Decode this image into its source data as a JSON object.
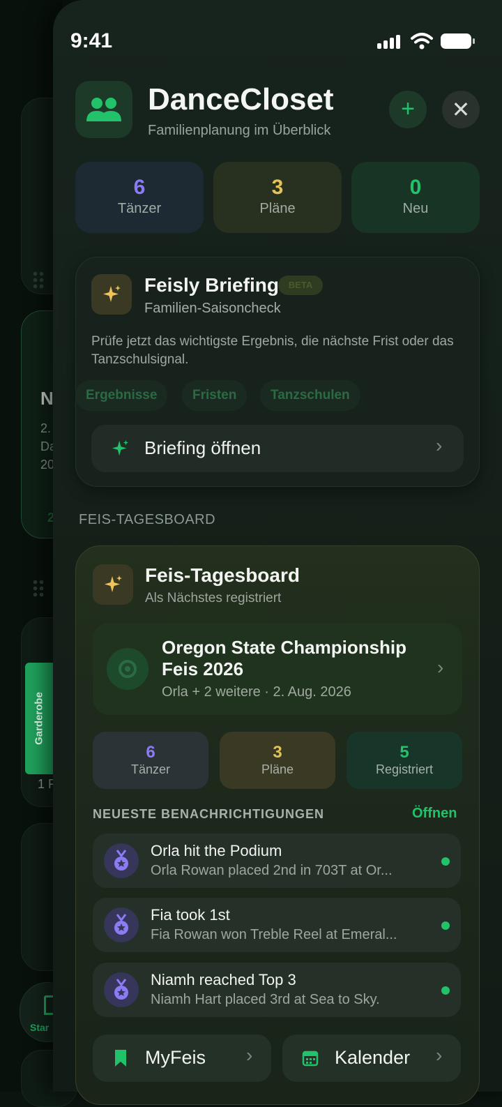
{
  "background_app": {
    "section_letter": "N",
    "lines": [
      "2.",
      "Da",
      "20"
    ],
    "badge": "2",
    "wardrobe_tab": "Garderobe",
    "footer_text": "1 F",
    "home_label": "Star"
  },
  "status_bar": {
    "time": "9:41"
  },
  "header": {
    "app_name": "DanceCloset",
    "subtitle": "Familienplanung im Überblick",
    "add_icon": "+",
    "close_icon": "✕"
  },
  "stats": [
    {
      "value": "6",
      "label": "Tänzer",
      "color": "#8b7cf6"
    },
    {
      "value": "3",
      "label": "Pläne",
      "color": "#e2c35a"
    },
    {
      "value": "0",
      "label": "Neu",
      "color": "#22c26a"
    }
  ],
  "briefing": {
    "title": "Feisly Briefing",
    "badge": "BETA",
    "subtitle": "Familien-Saisoncheck",
    "description": "Prüfe jetzt das wichtigste Ergebnis, die nächste Frist oder das Tanzschulsignal.",
    "chips": [
      "Ergebnisse",
      "Fristen",
      "Tanzschulen"
    ],
    "open_label": "Briefing öffnen"
  },
  "section_label": "FEIS-TAGESBOARD",
  "board": {
    "title": "Feis-Tagesboard",
    "subtitle": "Als Nächstes registriert",
    "event": {
      "title": "Oregon State Championship Feis 2026",
      "meta": "Orla + 2 weitere · 2. Aug. 2026"
    },
    "mini_stats": [
      {
        "value": "6",
        "label": "Tänzer",
        "color": "#8b7cf6"
      },
      {
        "value": "3",
        "label": "Pläne",
        "color": "#e2c35a"
      },
      {
        "value": "5",
        "label": "Registriert",
        "color": "#22c26a"
      }
    ],
    "notifications_title": "NEUESTE BENACHRICHTIGUNGEN",
    "notifications_open": "Öffnen",
    "notifications": [
      {
        "title": "Orla hit the Podium",
        "body": "Orla Rowan placed 2nd in 703T at Or..."
      },
      {
        "title": "Fia took 1st",
        "body": "Fia Rowan won Treble Reel at Emeral..."
      },
      {
        "title": "Niamh reached Top 3",
        "body": "Niamh Hart placed 3rd at Sea to Sky."
      }
    ],
    "quick_actions": [
      {
        "label": "MyFeis",
        "icon": "bookmark-icon"
      },
      {
        "label": "Kalender",
        "icon": "calendar-icon"
      }
    ]
  }
}
